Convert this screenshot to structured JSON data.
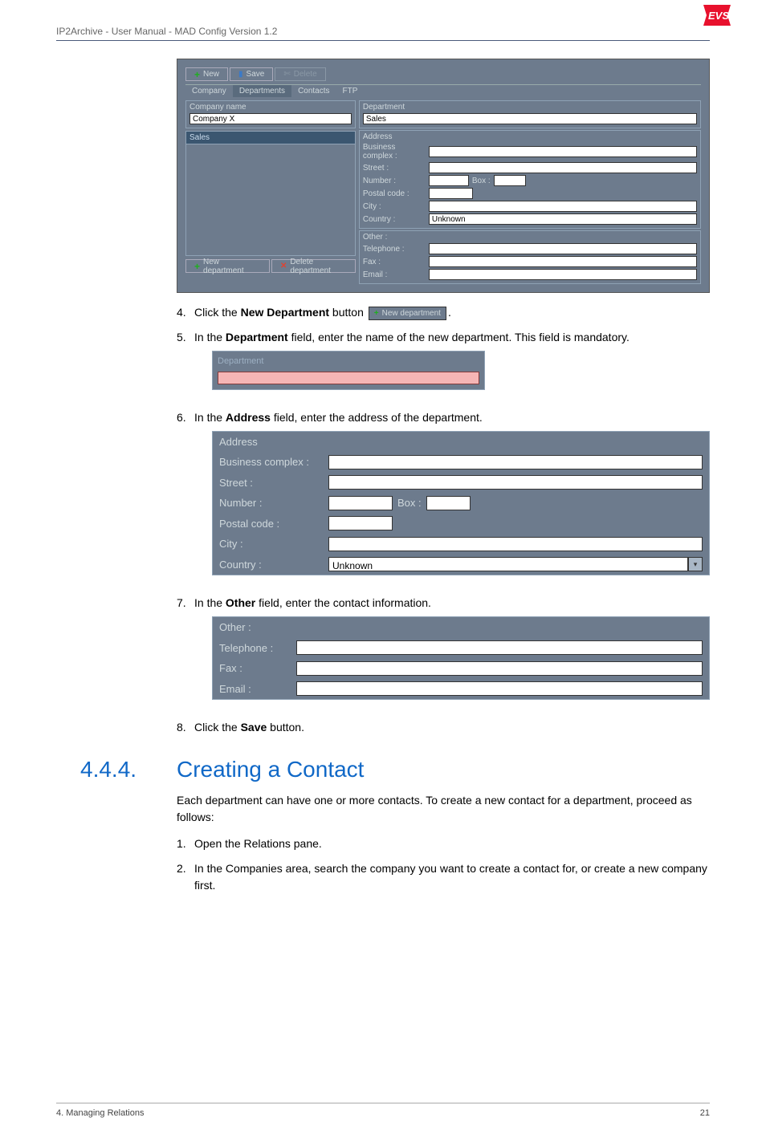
{
  "header": {
    "title": "IP2Archive - User Manual - MAD Config Version 1.2"
  },
  "logo": {
    "text": "EVS"
  },
  "panel": {
    "toolbar": {
      "new": "New",
      "save": "Save",
      "delete": "Delete"
    },
    "tabs": {
      "t1": "Company",
      "t2": "Departments",
      "t3": "Contacts",
      "t4": "FTP"
    },
    "left": {
      "company_label": "Company name",
      "company_value": "Company X",
      "list_head": "Sales",
      "new_dept": "New department",
      "del_dept": "Delete department"
    },
    "right": {
      "dept_label": "Department",
      "dept_value": "Sales",
      "addr_label": "Address",
      "biz": "Business complex :",
      "street": "Street :",
      "number": "Number :",
      "box": "Box :",
      "postal": "Postal code :",
      "city": "City :",
      "country": "Country :",
      "country_val": "Unknown",
      "other": "Other :",
      "tel": "Telephone :",
      "fax": "Fax :",
      "email": "Email :"
    }
  },
  "steps": {
    "s4n": "4.",
    "s4a": "Click the ",
    "s4b": "New Department",
    "s4c": " button ",
    "s4btn": "New department",
    "s4d": ".",
    "s5n": "5.",
    "s5a": "In the ",
    "s5b": "Department",
    "s5c": " field, enter the name of the new department. This field is mandatory.",
    "deptbox": "Department",
    "s6n": "6.",
    "s6a": "In the ",
    "s6b": "Address",
    "s6c": " field, enter the address of the department.",
    "s7n": "7.",
    "s7a": "In the ",
    "s7b": "Other",
    "s7c": " field, enter the contact information.",
    "s8n": "8.",
    "s8a": "Click the ",
    "s8b": "Save",
    "s8c": " button."
  },
  "addr_big": {
    "head": "Address",
    "biz": "Business complex :",
    "street": "Street :",
    "number": "Number :",
    "box": "Box :",
    "postal": "Postal code :",
    "city": "City :",
    "country": "Country :",
    "country_val": "Unknown"
  },
  "other_big": {
    "head": "Other :",
    "tel": "Telephone :",
    "fax": "Fax :",
    "email": "Email :"
  },
  "section": {
    "num": "4.4.4.",
    "title": "Creating a Contact",
    "p1": "Each department can have one or more contacts. To create a new contact for a department, proceed as follows:",
    "i1n": "1.",
    "i1": "Open the Relations pane.",
    "i2n": "2.",
    "i2": "In the Companies area, search the company you want to create a contact for, or create a new company first."
  },
  "footer": {
    "left": "4. Managing Relations",
    "right": "21"
  }
}
